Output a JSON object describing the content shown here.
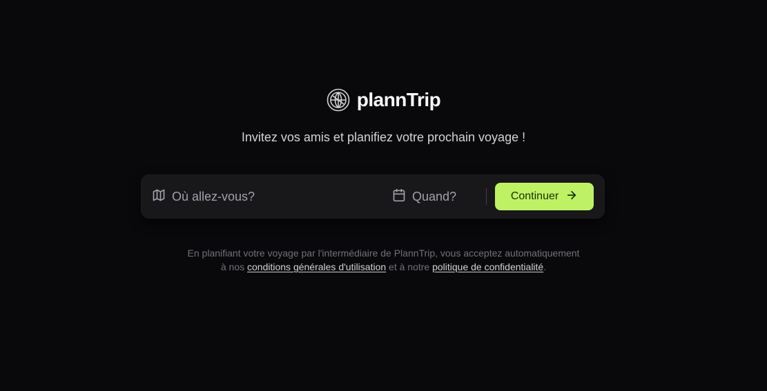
{
  "brand": {
    "name": "plannTrip"
  },
  "tagline": "Invitez vos amis et planifiez votre prochain voyage !",
  "search": {
    "destination_placeholder": "Où allez-vous?",
    "date_placeholder": "Quand?",
    "continue_label": "Continuer"
  },
  "legal": {
    "line1": "En planifiant votre voyage par l'intermédiaire de PlannTrip, vous acceptez automatiquement",
    "prefix": "à nos",
    "terms_link": "conditions générales d'utilisation",
    "middle": "et à notre",
    "privacy_link": "politique de confidentialité",
    "suffix": "."
  },
  "colors": {
    "background": "#09090b",
    "panel": "#18181b",
    "accent": "#bef264",
    "muted_text": "#a1a1aa"
  },
  "icons": {
    "logo": "globe-icon",
    "destination": "map-icon",
    "date": "calendar-icon",
    "continue": "arrow-right-icon"
  }
}
